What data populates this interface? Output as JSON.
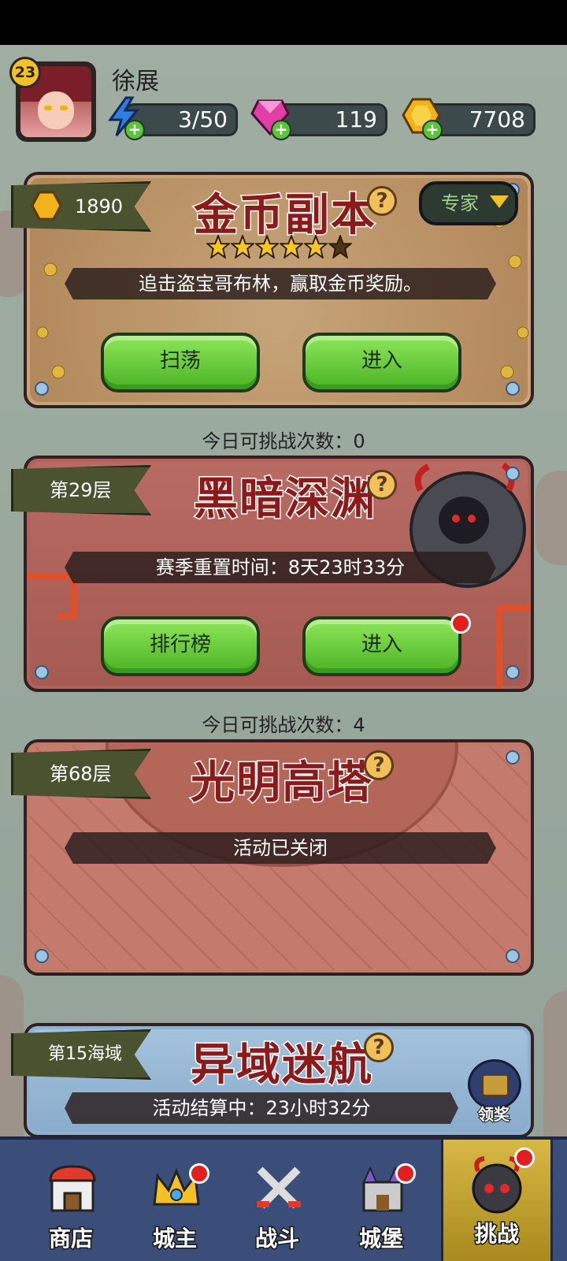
{
  "player": {
    "level": "23",
    "name": "徐展"
  },
  "resources": {
    "energy": "3/50",
    "gems": "119",
    "gold": "7708",
    "plus": "+"
  },
  "cards": {
    "gold": {
      "ribbon_value": "1890",
      "title": "金币副本",
      "help": "?",
      "difficulty": "专家",
      "stars": 5,
      "max_stars": 6,
      "desc": "追击盗宝哥布林，赢取金币奖励。",
      "btn_left": "扫荡",
      "btn_right": "进入",
      "attempts": "今日可挑战次数：0"
    },
    "abyss": {
      "ribbon": "第29层",
      "title": "黑暗深渊",
      "help": "?",
      "desc": "赛季重置时间：8天23时33分",
      "btn_left": "排行榜",
      "btn_right": "进入",
      "attempts": "今日可挑战次数：4"
    },
    "tower": {
      "ribbon": "第68层",
      "title": "光明高塔",
      "help": "?",
      "desc": "活动已关闭"
    },
    "voyage": {
      "ribbon": "第15海域",
      "title": "异域迷航",
      "help": "?",
      "desc": "活动结算中：23小时32分",
      "reward": "领奖"
    }
  },
  "nav": {
    "shop": "商店",
    "lord": "城主",
    "battle": "战斗",
    "castle": "城堡",
    "challenge": "挑战"
  },
  "colors": {
    "green": "#49b324",
    "title_red": "#8c1a1a",
    "nav_bg": "#3b4e7a",
    "active_tab": "#d7b845"
  }
}
